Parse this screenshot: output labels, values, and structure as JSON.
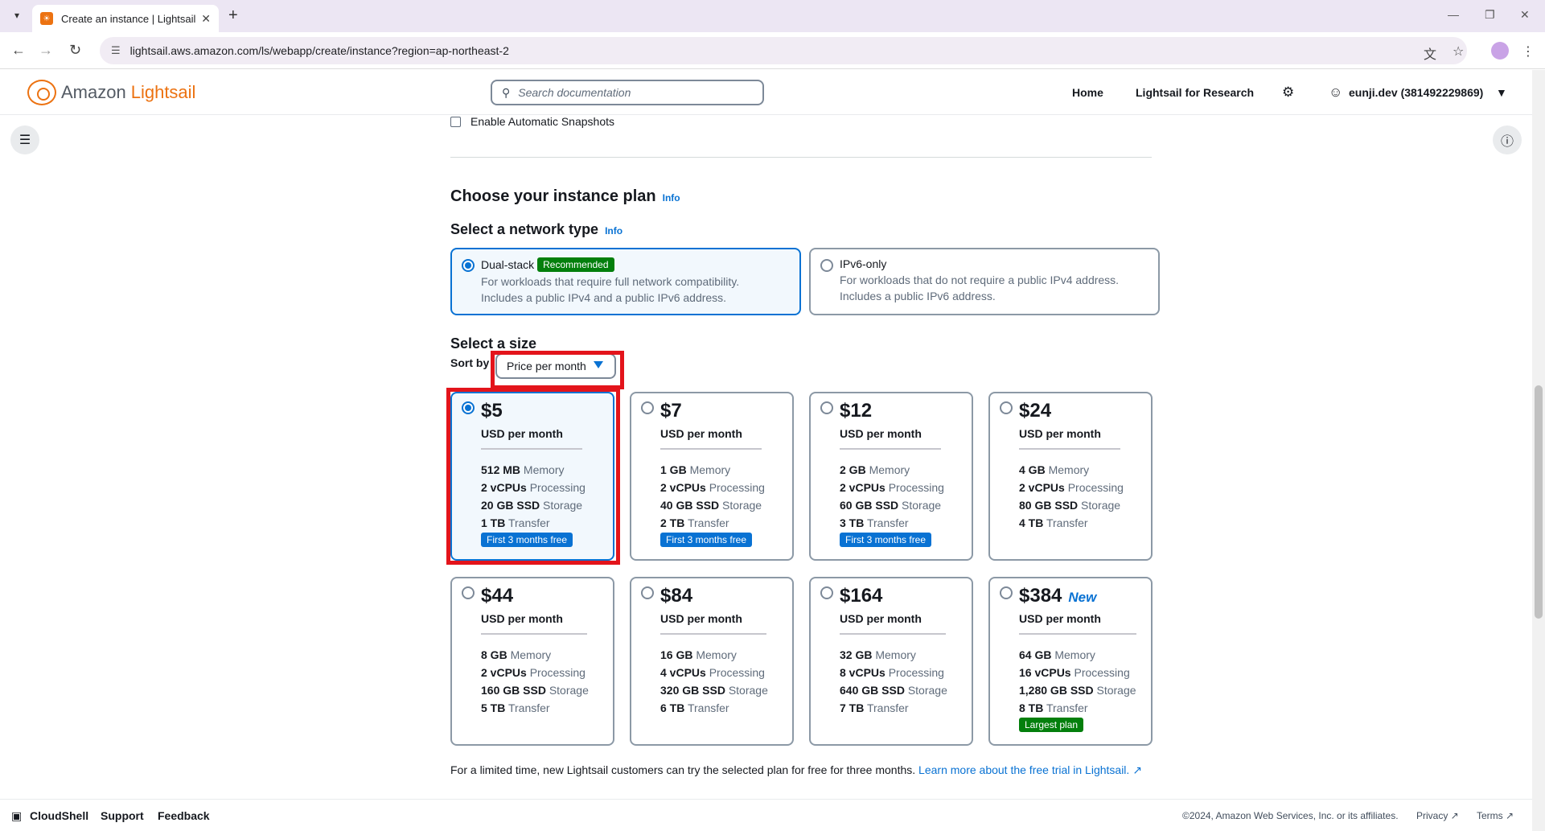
{
  "browser": {
    "tab_title": "Create an instance | Lightsail",
    "url": "lightsail.aws.amazon.com/ls/webapp/create/instance?region=ap-northeast-2"
  },
  "header": {
    "brand_prefix": "Amazon",
    "brand_name": "Lightsail",
    "search_placeholder": "Search documentation",
    "home": "Home",
    "research": "Lightsail for Research",
    "account": "eunji.dev (381492229869)"
  },
  "snapshots": {
    "label": "Enable Automatic Snapshots"
  },
  "plan_section": {
    "title": "Choose your instance plan",
    "info": "Info"
  },
  "network": {
    "title": "Select a network type",
    "info": "Info",
    "options": [
      {
        "name": "Dual-stack",
        "badge": "Recommended",
        "line1": "For workloads that require full network compatibility.",
        "line2": "Includes a public IPv4 and a public IPv6 address."
      },
      {
        "name": "IPv6-only",
        "badge": "",
        "line1": "For workloads that do not require a public IPv4 address.",
        "line2": "Includes a public IPv6 address."
      }
    ]
  },
  "size": {
    "title": "Select a size",
    "sort_label": "Sort by",
    "sort_value": "Price per month"
  },
  "plans": [
    {
      "price": "$5",
      "unit": "USD per month",
      "mem_v": "512 MB",
      "mem_l": "Memory",
      "cpu_v": "2 vCPUs",
      "cpu_l": "Processing",
      "sto_v": "20 GB SSD",
      "sto_l": "Storage",
      "tr_v": "1 TB",
      "tr_l": "Transfer",
      "badge": "First 3 months free"
    },
    {
      "price": "$7",
      "unit": "USD per month",
      "mem_v": "1 GB",
      "mem_l": "Memory",
      "cpu_v": "2 vCPUs",
      "cpu_l": "Processing",
      "sto_v": "40 GB SSD",
      "sto_l": "Storage",
      "tr_v": "2 TB",
      "tr_l": "Transfer",
      "badge": "First 3 months free"
    },
    {
      "price": "$12",
      "unit": "USD per month",
      "mem_v": "2 GB",
      "mem_l": "Memory",
      "cpu_v": "2 vCPUs",
      "cpu_l": "Processing",
      "sto_v": "60 GB SSD",
      "sto_l": "Storage",
      "tr_v": "3 TB",
      "tr_l": "Transfer",
      "badge": "First 3 months free"
    },
    {
      "price": "$24",
      "unit": "USD per month",
      "mem_v": "4 GB",
      "mem_l": "Memory",
      "cpu_v": "2 vCPUs",
      "cpu_l": "Processing",
      "sto_v": "80 GB SSD",
      "sto_l": "Storage",
      "tr_v": "4 TB",
      "tr_l": "Transfer",
      "badge": ""
    },
    {
      "price": "$44",
      "unit": "USD per month",
      "mem_v": "8 GB",
      "mem_l": "Memory",
      "cpu_v": "2 vCPUs",
      "cpu_l": "Processing",
      "sto_v": "160 GB SSD",
      "sto_l": "Storage",
      "tr_v": "5 TB",
      "tr_l": "Transfer",
      "badge": ""
    },
    {
      "price": "$84",
      "unit": "USD per month",
      "mem_v": "16 GB",
      "mem_l": "Memory",
      "cpu_v": "4 vCPUs",
      "cpu_l": "Processing",
      "sto_v": "320 GB SSD",
      "sto_l": "Storage",
      "tr_v": "6 TB",
      "tr_l": "Transfer",
      "badge": ""
    },
    {
      "price": "$164",
      "unit": "USD per month",
      "mem_v": "32 GB",
      "mem_l": "Memory",
      "cpu_v": "8 vCPUs",
      "cpu_l": "Processing",
      "sto_v": "640 GB SSD",
      "sto_l": "Storage",
      "tr_v": "7 TB",
      "tr_l": "Transfer",
      "badge": ""
    },
    {
      "price": "$384",
      "new_tag": "New",
      "unit": "USD per month",
      "mem_v": "64 GB",
      "mem_l": "Memory",
      "cpu_v": "16 vCPUs",
      "cpu_l": "Processing",
      "sto_v": "1,280 GB SSD",
      "sto_l": "Storage",
      "tr_v": "8 TB",
      "tr_l": "Transfer",
      "badge": "Largest plan"
    }
  ],
  "trial": {
    "text": "For a limited time, new Lightsail customers can try the selected plan for free for three months.",
    "link": "Learn more about the free trial in Lightsail."
  },
  "footer": {
    "cloudshell": "CloudShell",
    "support": "Support",
    "feedback": "Feedback",
    "copyright": "©2024, Amazon Web Services, Inc. or its affiliates.",
    "privacy": "Privacy",
    "terms": "Terms"
  },
  "colors": {
    "accent": "#0972d3",
    "brand": "#ec7211",
    "recommended": "#037f0c",
    "highlight": "#e3141b"
  },
  "icons": [
    "chevron-down-icon",
    "close-icon",
    "plus-icon",
    "back-icon",
    "forward-icon",
    "reload-icon",
    "site-settings-icon",
    "translate-icon",
    "star-icon",
    "more-icon",
    "search-icon",
    "gear-icon",
    "user-icon",
    "hamburger-icon",
    "info-icon",
    "external-link-icon",
    "cloudshell-icon"
  ]
}
